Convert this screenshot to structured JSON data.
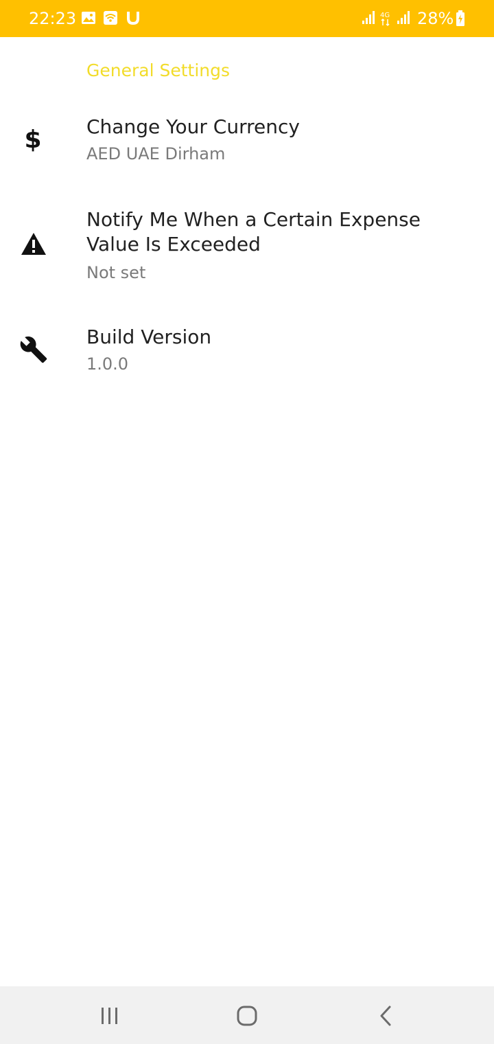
{
  "status_bar": {
    "time": "22:23",
    "battery": "28%",
    "color": "#FFC000",
    "icons": [
      "gallery-icon",
      "wifi-icon",
      "u-app-icon",
      "signal-icon",
      "4g-icon",
      "signal-icon",
      "battery-charging-icon"
    ]
  },
  "settings": {
    "section_header": "General Settings",
    "accent_color": "#F2DC2A",
    "items": [
      {
        "icon": "dollar-icon",
        "title": "Change Your Currency",
        "summary": "AED UAE Dirham"
      },
      {
        "icon": "warning-icon",
        "title": "Notify Me When a Certain Expense Value Is Exceeded",
        "summary": "Not set"
      },
      {
        "icon": "wrench-icon",
        "title": "Build Version",
        "summary": "1.0.0"
      }
    ]
  },
  "nav_bar": {
    "buttons": [
      "recents-icon",
      "home-icon",
      "back-icon"
    ]
  }
}
